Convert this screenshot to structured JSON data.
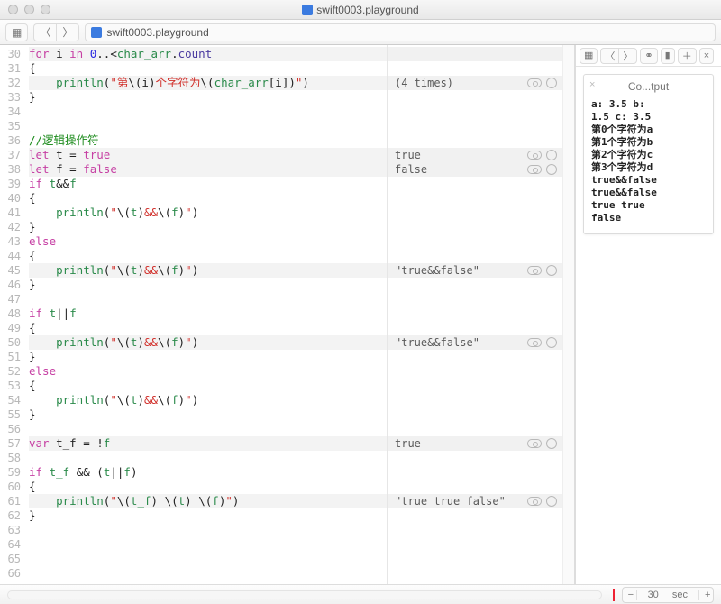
{
  "title": "swift0003.playground",
  "breadcrumb": "swift0003.playground",
  "timeline": {
    "value": "30",
    "unit": "sec"
  },
  "sidebar": {
    "title": "Co...tput"
  },
  "console_lines": [
    "a: 3.5 b:",
    "1.5 c: 3.5",
    "第0个字符为a",
    "第1个字符为b",
    "第2个字符为c",
    "第3个字符为d",
    "true&&false",
    "true&&false",
    "true true",
    "false"
  ],
  "lines": [
    {
      "n": 30,
      "hl": true,
      "tokens": [
        [
          "kw",
          "for"
        ],
        [
          "",
          " i "
        ],
        [
          "kw",
          "in"
        ],
        [
          "",
          " "
        ],
        [
          "num",
          "0"
        ],
        [
          "",
          "..<"
        ],
        [
          "ident",
          "char_arr"
        ],
        [
          "",
          "."
        ],
        [
          "prop",
          "count"
        ]
      ]
    },
    {
      "n": 31,
      "tokens": [
        [
          "",
          "{"
        ]
      ]
    },
    {
      "n": 32,
      "hl": true,
      "tokens": [
        [
          "",
          "    "
        ],
        [
          "ident",
          "println"
        ],
        [
          "",
          "("
        ],
        [
          "str",
          "\"第"
        ],
        [
          "interp",
          "\\("
        ],
        [
          "",
          "i"
        ],
        [
          "interp",
          ")"
        ],
        [
          "str",
          "个字符为"
        ],
        [
          "interp",
          "\\("
        ],
        [
          "ident",
          "char_arr"
        ],
        [
          "",
          "[i]"
        ],
        [
          "interp",
          ")"
        ],
        [
          "str",
          "\""
        ],
        [
          "",
          ")"
        ]
      ],
      "result": "(4 times)",
      "icons": true
    },
    {
      "n": 33,
      "tokens": [
        [
          "",
          "}"
        ]
      ]
    },
    {
      "n": 34,
      "tokens": []
    },
    {
      "n": 35,
      "tokens": []
    },
    {
      "n": 36,
      "tokens": [
        [
          "cm",
          "//逻辑操作符"
        ]
      ]
    },
    {
      "n": 37,
      "hl": true,
      "tokens": [
        [
          "kw",
          "let"
        ],
        [
          "",
          " t = "
        ],
        [
          "kw",
          "true"
        ]
      ],
      "result": "true",
      "icons": true
    },
    {
      "n": 38,
      "hl": true,
      "tokens": [
        [
          "kw",
          "let"
        ],
        [
          "",
          " f = "
        ],
        [
          "kw",
          "false"
        ]
      ],
      "result": "false",
      "icons": true
    },
    {
      "n": 39,
      "tokens": [
        [
          "kw",
          "if"
        ],
        [
          "",
          " "
        ],
        [
          "ident",
          "t"
        ],
        [
          "",
          "&&"
        ],
        [
          "ident",
          "f"
        ]
      ]
    },
    {
      "n": 40,
      "tokens": [
        [
          "",
          "{"
        ]
      ]
    },
    {
      "n": 41,
      "tokens": [
        [
          "",
          "    "
        ],
        [
          "ident",
          "println"
        ],
        [
          "",
          "("
        ],
        [
          "str",
          "\""
        ],
        [
          "interp",
          "\\("
        ],
        [
          "ident",
          "t"
        ],
        [
          "interp",
          ")"
        ],
        [
          "str",
          "&&"
        ],
        [
          "interp",
          "\\("
        ],
        [
          "ident",
          "f"
        ],
        [
          "interp",
          ")"
        ],
        [
          "str",
          "\""
        ],
        [
          "",
          ")"
        ]
      ]
    },
    {
      "n": 42,
      "tokens": [
        [
          "",
          "}"
        ]
      ]
    },
    {
      "n": 43,
      "tokens": [
        [
          "kw",
          "else"
        ]
      ]
    },
    {
      "n": 44,
      "tokens": [
        [
          "",
          "{"
        ]
      ]
    },
    {
      "n": 45,
      "hl": true,
      "tokens": [
        [
          "",
          "    "
        ],
        [
          "ident",
          "println"
        ],
        [
          "",
          "("
        ],
        [
          "str",
          "\""
        ],
        [
          "interp",
          "\\("
        ],
        [
          "ident",
          "t"
        ],
        [
          "interp",
          ")"
        ],
        [
          "str",
          "&&"
        ],
        [
          "interp",
          "\\("
        ],
        [
          "ident",
          "f"
        ],
        [
          "interp",
          ")"
        ],
        [
          "str",
          "\""
        ],
        [
          "",
          ")"
        ]
      ],
      "result": "\"true&&false\"",
      "icons": true
    },
    {
      "n": 46,
      "tokens": [
        [
          "",
          "}"
        ]
      ]
    },
    {
      "n": 47,
      "tokens": []
    },
    {
      "n": 48,
      "tokens": [
        [
          "kw",
          "if"
        ],
        [
          "",
          " "
        ],
        [
          "ident",
          "t"
        ],
        [
          "",
          "||"
        ],
        [
          "ident",
          "f"
        ]
      ]
    },
    {
      "n": 49,
      "tokens": [
        [
          "",
          "{"
        ]
      ]
    },
    {
      "n": 50,
      "hl": true,
      "tokens": [
        [
          "",
          "    "
        ],
        [
          "ident",
          "println"
        ],
        [
          "",
          "("
        ],
        [
          "str",
          "\""
        ],
        [
          "interp",
          "\\("
        ],
        [
          "ident",
          "t"
        ],
        [
          "interp",
          ")"
        ],
        [
          "str",
          "&&"
        ],
        [
          "interp",
          "\\("
        ],
        [
          "ident",
          "f"
        ],
        [
          "interp",
          ")"
        ],
        [
          "str",
          "\""
        ],
        [
          "",
          ")"
        ]
      ],
      "result": "\"true&&false\"",
      "icons": true
    },
    {
      "n": 51,
      "tokens": [
        [
          "",
          "}"
        ]
      ]
    },
    {
      "n": 52,
      "tokens": [
        [
          "kw",
          "else"
        ]
      ]
    },
    {
      "n": 53,
      "tokens": [
        [
          "",
          "{"
        ]
      ]
    },
    {
      "n": 54,
      "tokens": [
        [
          "",
          "    "
        ],
        [
          "ident",
          "println"
        ],
        [
          "",
          "("
        ],
        [
          "str",
          "\""
        ],
        [
          "interp",
          "\\("
        ],
        [
          "ident",
          "t"
        ],
        [
          "interp",
          ")"
        ],
        [
          "str",
          "&&"
        ],
        [
          "interp",
          "\\("
        ],
        [
          "ident",
          "f"
        ],
        [
          "interp",
          ")"
        ],
        [
          "str",
          "\""
        ],
        [
          "",
          ")"
        ]
      ]
    },
    {
      "n": 55,
      "tokens": [
        [
          "",
          "}"
        ]
      ]
    },
    {
      "n": 56,
      "tokens": []
    },
    {
      "n": 57,
      "hl": true,
      "tokens": [
        [
          "kw",
          "var"
        ],
        [
          "",
          " t_f = !"
        ],
        [
          "ident",
          "f"
        ]
      ],
      "result": "true",
      "icons": true
    },
    {
      "n": 58,
      "tokens": []
    },
    {
      "n": 59,
      "tokens": [
        [
          "kw",
          "if"
        ],
        [
          "",
          " "
        ],
        [
          "ident",
          "t_f"
        ],
        [
          "",
          " && ("
        ],
        [
          "ident",
          "t"
        ],
        [
          "",
          "||"
        ],
        [
          "ident",
          "f"
        ],
        [
          "",
          ")"
        ]
      ]
    },
    {
      "n": 60,
      "tokens": [
        [
          "",
          "{"
        ]
      ]
    },
    {
      "n": 61,
      "hl": true,
      "tokens": [
        [
          "",
          "    "
        ],
        [
          "ident",
          "println"
        ],
        [
          "",
          "("
        ],
        [
          "str",
          "\""
        ],
        [
          "interp",
          "\\("
        ],
        [
          "ident",
          "t_f"
        ],
        [
          "interp",
          ")"
        ],
        [
          "str",
          " "
        ],
        [
          "interp",
          "\\("
        ],
        [
          "ident",
          "t"
        ],
        [
          "interp",
          ")"
        ],
        [
          "str",
          " "
        ],
        [
          "interp",
          "\\("
        ],
        [
          "ident",
          "f"
        ],
        [
          "interp",
          ")"
        ],
        [
          "str",
          "\""
        ],
        [
          "",
          ")"
        ]
      ],
      "result": "\"true true false\"",
      "icons": true
    },
    {
      "n": 62,
      "tokens": [
        [
          "",
          "}"
        ]
      ]
    },
    {
      "n": 63,
      "tokens": []
    },
    {
      "n": 64,
      "tokens": []
    },
    {
      "n": 65,
      "tokens": []
    },
    {
      "n": 66,
      "tokens": []
    }
  ]
}
